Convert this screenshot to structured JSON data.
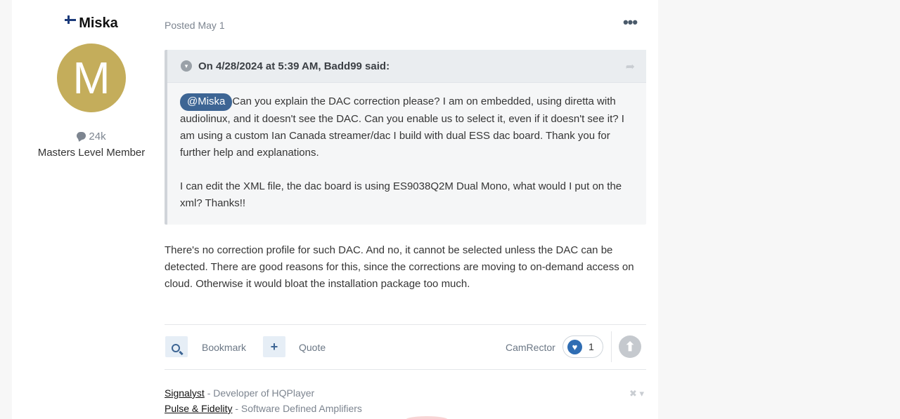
{
  "author": {
    "name": "Miska",
    "avatar_letter": "M",
    "post_count": "24k",
    "rank": "Masters Level Member"
  },
  "post": {
    "posted": "Posted May 1",
    "more_glyph": "•••",
    "quote": {
      "header": "On 4/28/2024 at 5:39 AM, Badd99 said:",
      "mention": "@Miska",
      "para1": "Can you explain the DAC correction please? I am on embedded, using diretta with audiolinux, and it doesn't see the DAC. Can you enable us to select it, even if it doesn't see it? I am using a custom Ian Canada streamer/dac I build with dual ESS dac board. Thank you for further help and explanations.",
      "para2": "I can edit the XML file, the dac board is using ES9038Q2M Dual Mono, what would I put on the xml? Thanks!!"
    },
    "reply": "There's no correction profile for such DAC. And no, it cannot be selected unless the DAC can be detected. There are good reasons for this, since the corrections are moving to on-demand access on cloud. Otherwise it would bloat the installation package too much."
  },
  "actions": {
    "bookmark": "Bookmark",
    "quote": "Quote",
    "plus_glyph": "+",
    "liker": "CamRector",
    "reaction_count": "1",
    "heart_glyph": "♥",
    "upvote_glyph": "⬆"
  },
  "signature": {
    "line1_link": "Signalyst",
    "line1_text": " - Developer of HQPlayer",
    "line2_link": "Pulse & Fidelity",
    "line2_text": " - Software Defined Amplifiers",
    "close_glyph": "✖ ▾"
  },
  "colors": {
    "accent": "#3d6594",
    "avatar_bg": "#c4ad5b",
    "reaction_blue": "#2f6db3"
  }
}
